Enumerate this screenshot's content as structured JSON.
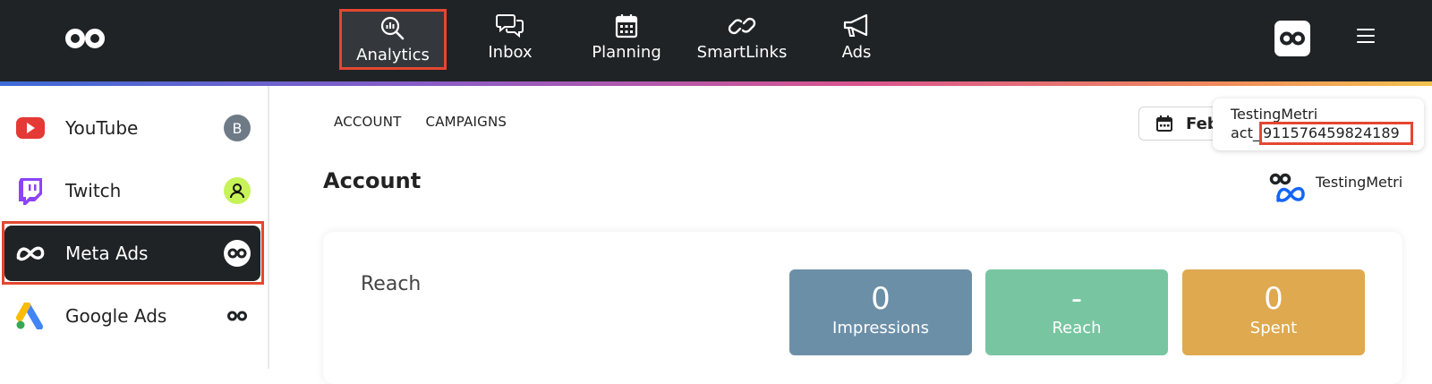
{
  "nav": {
    "items": [
      {
        "label": "Analytics",
        "icon": "analytics-icon",
        "active": true
      },
      {
        "label": "Inbox",
        "icon": "chat-icon"
      },
      {
        "label": "Planning",
        "icon": "calendar-icon"
      },
      {
        "label": "SmartLinks",
        "icon": "link-icon"
      },
      {
        "label": "Ads",
        "icon": "megaphone-icon"
      }
    ]
  },
  "sidebar": {
    "items": [
      {
        "label": "YouTube",
        "badge": "B",
        "badge_color": "#6e7a86"
      },
      {
        "label": "Twitch",
        "badge_color": "#c7f258"
      },
      {
        "label": "Meta Ads",
        "active": true
      },
      {
        "label": "Google Ads"
      }
    ]
  },
  "tabs": [
    "ACCOUNT",
    "CAMPAIGNS"
  ],
  "date_button": {
    "label": "Feb"
  },
  "tooltip": {
    "name": "TestingMetri",
    "prefix": "act_",
    "id": "911576459824189"
  },
  "page_title": "Account",
  "account_chip": {
    "name": "TestingMetri"
  },
  "card": {
    "title": "Reach",
    "metrics": [
      {
        "value": "0",
        "label": "Impressions",
        "color": "#6c8fa8"
      },
      {
        "value": "-",
        "label": "Reach",
        "color": "#77c6a1"
      },
      {
        "value": "0",
        "label": "Spent",
        "color": "#dea94f"
      }
    ]
  },
  "colors": {
    "topbar": "#1f2326",
    "highlight": "#e4472f"
  }
}
